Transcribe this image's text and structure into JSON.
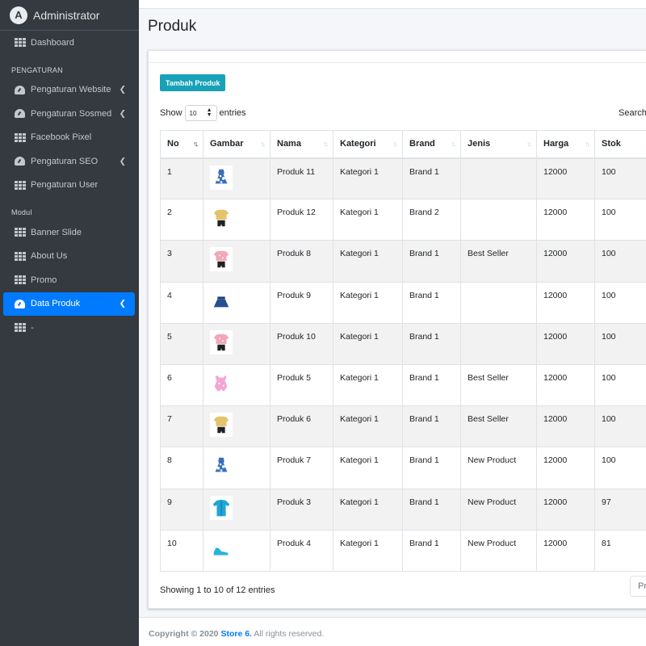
{
  "brand": {
    "text": "Administrator",
    "logo_letter": "A",
    "logo_icon": "app-logo"
  },
  "sidebar": {
    "items": [
      {
        "label": "Dashboard",
        "icon": "grid-icon",
        "arrow": false,
        "active": false
      },
      {
        "header": "PENGATURAN"
      },
      {
        "label": "Pengaturan Website",
        "icon": "gauge-icon",
        "arrow": true,
        "active": false
      },
      {
        "label": "Pengaturan Sosmed",
        "icon": "gauge-icon",
        "arrow": true,
        "active": false
      },
      {
        "label": "Facebook Pixel",
        "icon": "grid-icon",
        "arrow": false,
        "active": false
      },
      {
        "label": "Pengaturan SEO",
        "icon": "gauge-icon",
        "arrow": true,
        "active": false
      },
      {
        "label": "Pengaturan User",
        "icon": "grid-icon",
        "arrow": false,
        "active": false
      },
      {
        "header": "Modul"
      },
      {
        "label": "Banner Slide",
        "icon": "grid-icon",
        "arrow": false,
        "active": false
      },
      {
        "label": "About Us",
        "icon": "grid-icon",
        "arrow": false,
        "active": false
      },
      {
        "label": "Promo",
        "icon": "grid-icon",
        "arrow": false,
        "active": false
      },
      {
        "label": "Data Produk",
        "icon": "gauge-icon",
        "arrow": true,
        "active": true
      },
      {
        "label": "-",
        "icon": "grid-icon",
        "arrow": false,
        "active": false
      }
    ]
  },
  "page": {
    "title": "Produk",
    "add_button": "Tambah Produk",
    "show_label": "Show",
    "entries_label": "entries",
    "page_length": "10",
    "search_label": "Search:",
    "info": "Showing 1 to 10 of 12 entries",
    "prev_label": "Pr"
  },
  "table": {
    "columns": [
      "No",
      "Gambar",
      "Nama",
      "Kategori",
      "Brand",
      "Jenis",
      "Harga",
      "Stok"
    ],
    "sorted_column": "No",
    "rows": [
      {
        "no": "1",
        "image": "dress-blue-floral",
        "nama": "Produk 11",
        "kategori": "Kategori 1",
        "brand": "Brand 1",
        "jenis": "",
        "harga": "12000",
        "stok": "100"
      },
      {
        "no": "2",
        "image": "shirt-yellow-shorts",
        "nama": "Produk 12",
        "kategori": "Kategori 1",
        "brand": "Brand 2",
        "jenis": "",
        "harga": "12000",
        "stok": "100"
      },
      {
        "no": "3",
        "image": "shirt-pink-set",
        "nama": "Produk 8",
        "kategori": "Kategori 1",
        "brand": "Brand 1",
        "jenis": "Best Seller",
        "harga": "12000",
        "stok": "100"
      },
      {
        "no": "4",
        "image": "skirt-navy",
        "nama": "Produk 9",
        "kategori": "Kategori 1",
        "brand": "Brand 1",
        "jenis": "",
        "harga": "12000",
        "stok": "100"
      },
      {
        "no": "5",
        "image": "shirt-pink-set",
        "nama": "Produk 10",
        "kategori": "Kategori 1",
        "brand": "Brand 1",
        "jenis": "",
        "harga": "12000",
        "stok": "100"
      },
      {
        "no": "6",
        "image": "romper-pink",
        "nama": "Produk 5",
        "kategori": "Kategori 1",
        "brand": "Brand 1",
        "jenis": "Best Seller",
        "harga": "12000",
        "stok": "100"
      },
      {
        "no": "7",
        "image": "shirt-yellow-shorts",
        "nama": "Produk 6",
        "kategori": "Kategori 1",
        "brand": "Brand 1",
        "jenis": "Best Seller",
        "harga": "12000",
        "stok": "100"
      },
      {
        "no": "8",
        "image": "dress-blue-floral",
        "nama": "Produk 7",
        "kategori": "Kategori 1",
        "brand": "Brand 1",
        "jenis": "New Product",
        "harga": "12000",
        "stok": "100"
      },
      {
        "no": "9",
        "image": "jacket-cyan",
        "nama": "Produk 3",
        "kategori": "Kategori 1",
        "brand": "Brand 1",
        "jenis": "New Product",
        "harga": "12000",
        "stok": "97"
      },
      {
        "no": "10",
        "image": "shoes-cyan",
        "nama": "Produk 4",
        "kategori": "Kategori 1",
        "brand": "Brand 1",
        "jenis": "New Product",
        "harga": "12000",
        "stok": "81"
      }
    ]
  },
  "footer": {
    "copyright": "Copyright © 2020",
    "store": "Store 6.",
    "rights": "All rights reserved."
  },
  "colors": {
    "sidebar_bg": "#343a40",
    "active": "#007bff",
    "add_button": "#17a2b8"
  }
}
